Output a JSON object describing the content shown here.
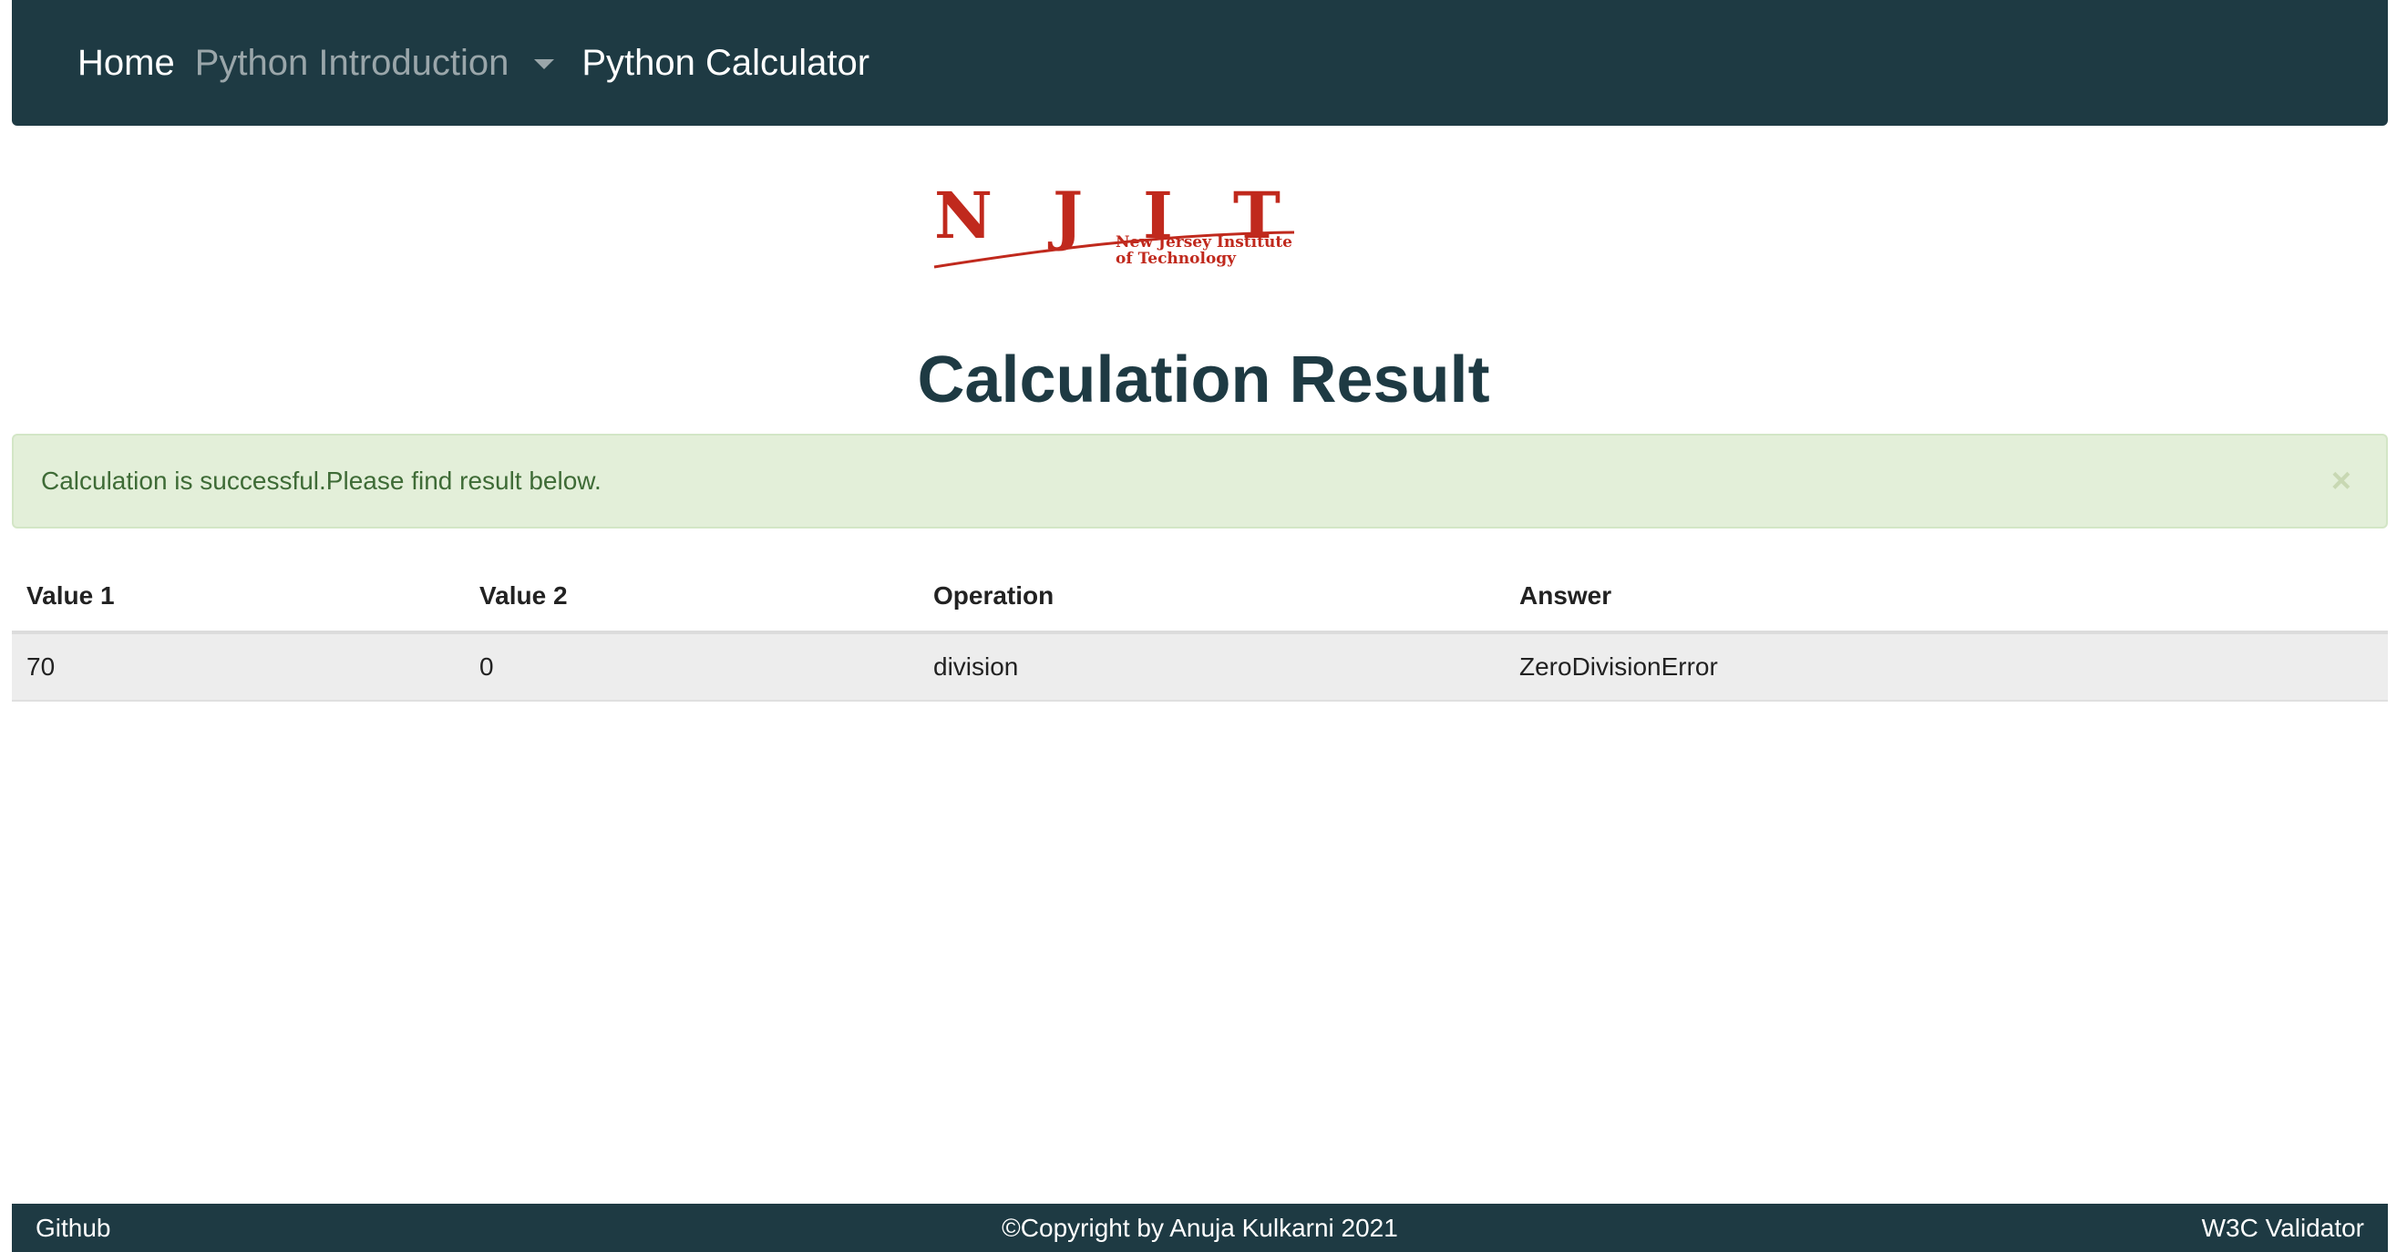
{
  "nav": {
    "home": "Home",
    "python_intro": "Python Introduction",
    "calculator": "Python Calculator"
  },
  "logo": {
    "letters": "N J I T",
    "line1": "New Jersey Institute",
    "line2": "of Technology",
    "color": "#c0291d"
  },
  "title": "Calculation Result",
  "alert": {
    "message": "Calculation is successful.Please find result below.",
    "close": "×"
  },
  "table": {
    "headers": [
      "Value 1",
      "Value 2",
      "Operation",
      "Answer"
    ],
    "rows": [
      [
        "70",
        "0",
        "division",
        "ZeroDivisionError"
      ]
    ]
  },
  "footer": {
    "left": "Github",
    "center": "©Copyright by Anuja Kulkarni 2021",
    "right": "W3C Validator"
  },
  "colors": {
    "primary": "#1e3a43",
    "alert_bg": "#e3efd9",
    "alert_text": "#3e6b36"
  }
}
